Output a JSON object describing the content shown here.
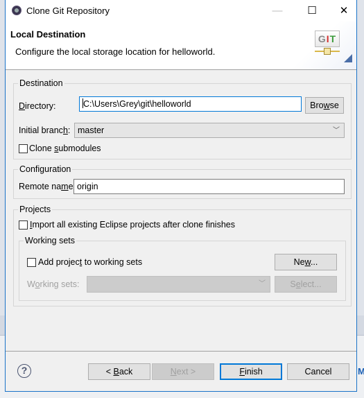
{
  "window": {
    "title": "Clone Git Repository",
    "controls": {
      "minimize": "—",
      "maximize": "☐",
      "close": "✕"
    }
  },
  "header": {
    "title": "Local Destination",
    "description": "Configure the local storage location for helloworld.",
    "logo": {
      "g": "G",
      "i": "I",
      "t": "T"
    }
  },
  "destination": {
    "group_label": "Destination",
    "directory": {
      "label_u": "D",
      "label_rest": "irectory:",
      "value": "C:\\Users\\Grey\\git\\helloworld"
    },
    "browse": {
      "pre": "Bro",
      "u": "w",
      "post": "se"
    },
    "initial_branch": {
      "label_pre": "Initial branc",
      "label_u": "h",
      "label_post": ":",
      "value": "master"
    },
    "clone_submodules": {
      "label_pre": "Clone ",
      "label_u": "s",
      "label_post": "ubmodules",
      "checked": false
    }
  },
  "configuration": {
    "group_label": "Configuration",
    "remote_name": {
      "label_pre": "Remote na",
      "label_u": "m",
      "label_post": "e:",
      "value": "origin"
    }
  },
  "projects": {
    "group_label": "Projects",
    "import_all": {
      "label_u": "I",
      "label_rest": "mport all existing Eclipse projects after clone finishes",
      "checked": false
    },
    "working_sets": {
      "group_label": "Working sets",
      "add_to_sets": {
        "label_pre": "Add projec",
        "label_u": "t",
        "label_post": " to working sets",
        "checked": false
      },
      "new_button": {
        "pre": "Ne",
        "u": "w",
        "post": "..."
      },
      "sets_label": {
        "pre": "W",
        "u": "o",
        "post": "rking sets:"
      },
      "sets_value": "",
      "select_button": {
        "pre": "S",
        "u": "e",
        "post": "lect..."
      }
    }
  },
  "footer": {
    "help": "?",
    "back": {
      "pre": "< ",
      "u": "B",
      "post": "ack"
    },
    "next": {
      "u": "N",
      "post": "ext >"
    },
    "finish": {
      "u": "F",
      "post": "inish"
    },
    "cancel": "Cancel"
  },
  "background": {
    "letter": "M"
  }
}
